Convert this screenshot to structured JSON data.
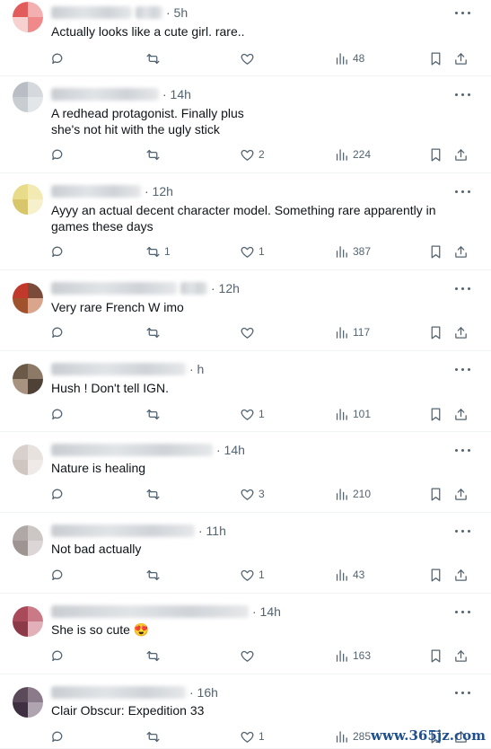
{
  "replies": [
    {
      "time": "5h",
      "text": "Actually looks like a cute girl. rare..",
      "replies": "",
      "reposts": "",
      "likes": "",
      "views": "48",
      "avatar": [
        "#e25c5c",
        "#f3b0b0",
        "#f7d0d0",
        "#f08a8a"
      ]
    },
    {
      "time": "14h",
      "text": "A redhead protagonist. Finally plus she's not hit with the ugly stick",
      "replies": "",
      "reposts": "",
      "likes": "2",
      "views": "224",
      "avatar": [
        "#b8bec4",
        "#d5d9dd",
        "#c8cdd2",
        "#e3e6e9"
      ]
    },
    {
      "time": "12h",
      "text": "Ayyy an actual decent character model. Something rare apparently in games these days",
      "replies": "",
      "reposts": "1",
      "likes": "1",
      "views": "387",
      "avatar": [
        "#e8dc8a",
        "#f3eab3",
        "#d7c66c",
        "#f6f0cc"
      ]
    },
    {
      "time": "12h",
      "text": "Very rare French W imo",
      "replies": "",
      "reposts": "",
      "likes": "",
      "views": "117",
      "avatar": [
        "#c0392b",
        "#7a4a3a",
        "#a0522d",
        "#d9a58c"
      ]
    },
    {
      "time": "h",
      "text": "Hush ! Don't tell IGN.",
      "replies": "",
      "reposts": "",
      "likes": "1",
      "views": "101",
      "avatar": [
        "#6b5a48",
        "#8c7a66",
        "#a89380",
        "#4e4236"
      ]
    },
    {
      "time": "14h",
      "text": "Nature is healing",
      "replies": "",
      "reposts": "",
      "likes": "3",
      "views": "210",
      "avatar": [
        "#d8d0cc",
        "#e8e2df",
        "#cfc6c2",
        "#efeae8"
      ]
    },
    {
      "time": "11h",
      "text": "Not bad actually",
      "replies": "",
      "reposts": "",
      "likes": "1",
      "views": "43",
      "avatar": [
        "#b0a8a6",
        "#ccc6c4",
        "#9e9593",
        "#dcd7d6"
      ]
    },
    {
      "time": "14h",
      "text": "She is so cute 😍",
      "replies": "",
      "reposts": "",
      "likes": "",
      "views": "163",
      "avatar": [
        "#a84a5a",
        "#c97a86",
        "#8c3a48",
        "#e2b0b8"
      ]
    },
    {
      "time": "16h",
      "text": "Clair Obscur: Expedition 33",
      "replies": "",
      "reposts": "",
      "likes": "1",
      "views": "285",
      "avatar": [
        "#5a4a5a",
        "#8a7a8a",
        "#3e3040",
        "#b0a4b0"
      ]
    }
  ],
  "header_fragments": [
    "",
    "@",
    "",
    "",
    "",
    "",
    "",
    "",
    "26 ·",
    "",
    "Sc 75 ·",
    "",
    ""
  ],
  "watermark": "www.365jz.com"
}
